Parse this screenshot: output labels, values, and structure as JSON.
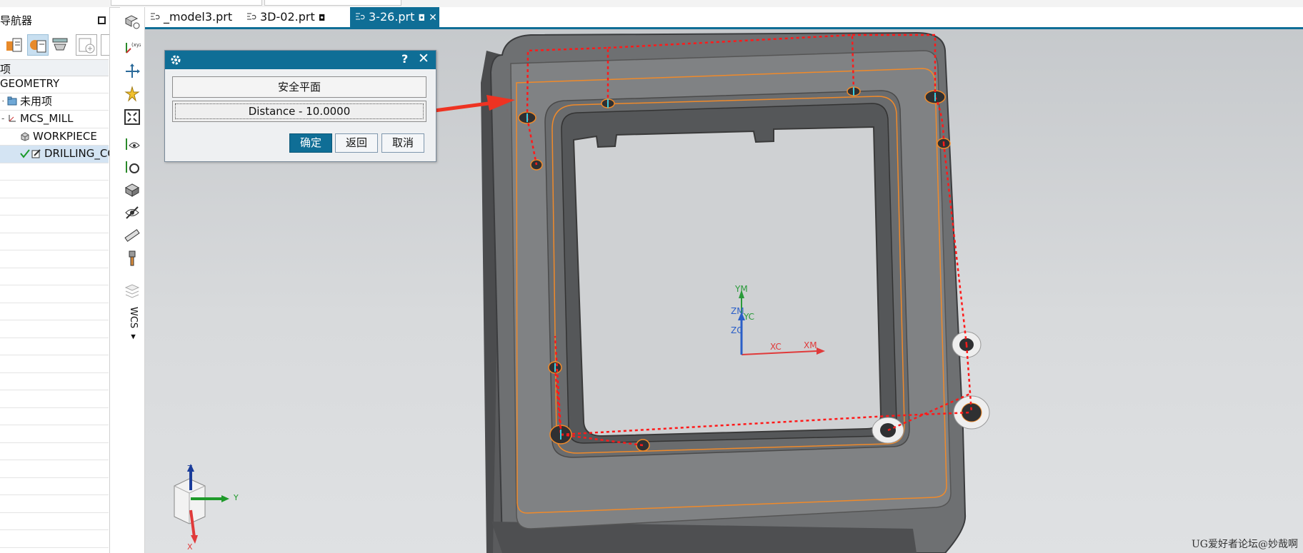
{
  "navigator": {
    "title": "导航器",
    "column_header": "项",
    "rows": [
      {
        "label": "GEOMETRY"
      },
      {
        "label": "未用项"
      },
      {
        "label": "MCS_MILL"
      },
      {
        "label": "WORKPIECE"
      },
      {
        "label": "DRILLING_CO"
      }
    ]
  },
  "tabs": [
    {
      "label": "_model3.prt"
    },
    {
      "label": "3D-02.prt"
    },
    {
      "label": "3-26.prt"
    }
  ],
  "dialog": {
    "safe_plane_label": "安全平面",
    "distance_label": "Distance - 10.0000",
    "help_symbol": "?",
    "close_symbol": "✕",
    "ok_label": "确定",
    "back_label": "返回",
    "cancel_label": "取消"
  },
  "vertical_toolbar": {
    "wcs_label": "WCS"
  },
  "viewport": {
    "axes": {
      "ym": "YM",
      "zm": "ZM",
      "yc": "YC",
      "zc": "ZC",
      "xc": "XC",
      "xm": "XM"
    },
    "triad": {
      "z": "Z",
      "y": "Y",
      "x": "X"
    }
  },
  "watermark": "UG爱好者论坛@妙哉啊",
  "colors": {
    "accent": "#0f6e96",
    "toolpath": "#ff1a1a",
    "arrow": "#ee3322",
    "edge_highlight": "#f08a2a"
  }
}
